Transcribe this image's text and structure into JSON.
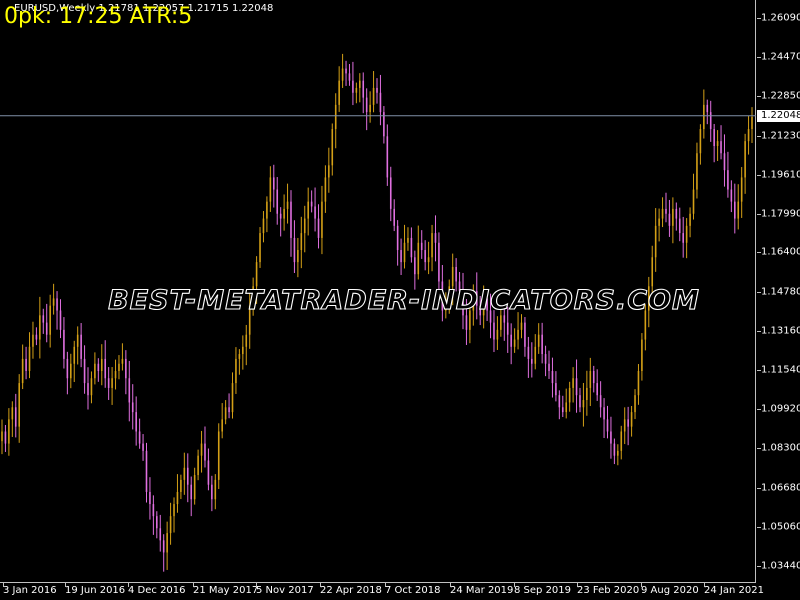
{
  "chart": {
    "symbol_title": "EURUSD,Weekly  1.21781 1.22057 1.21715 1.22048",
    "indicator_text": "0pk: 17:25 ATR:5",
    "watermark": "BEST-METATRADER-INDICATORS.COM",
    "current_price": "1.22048",
    "price_labels": [
      "1.26090",
      "1.24470",
      "1.22850",
      "1.21230",
      "1.19610",
      "1.17990",
      "1.16400",
      "1.14780",
      "1.13160",
      "1.11540",
      "1.09920",
      "1.08300",
      "1.06680",
      "1.05060",
      "1.03440"
    ],
    "time_labels": [
      "3 Jan 2016",
      "19 Jun 2016",
      "4 Dec 2016",
      "21 May 2017",
      "5 Nov 2017",
      "22 Apr 2018",
      "7 Oct 2018",
      "24 Mar 2019",
      "8 Sep 2019",
      "23 Feb 2020",
      "9 Aug 2020",
      "24 Jan 2021"
    ],
    "colors": {
      "background": "#000000",
      "bull": "#d4a017",
      "bear": "#e070e0",
      "axis_text": "#ffffff",
      "indicator": "#ffff00",
      "current_line": "#8090a8"
    }
  },
  "chart_data": {
    "type": "candlestick",
    "title": "EURUSD,Weekly",
    "ylim": [
      1.0344,
      1.2609
    ],
    "series": [
      {
        "name": "EURUSD",
        "values": [
          1.09,
          1.085,
          1.095,
          1.1,
          1.092,
          1.11,
          1.12,
          1.115,
          1.125,
          1.13,
          1.128,
          1.138,
          1.135,
          1.13,
          1.142,
          1.145,
          1.14,
          1.132,
          1.12,
          1.112,
          1.118,
          1.125,
          1.13,
          1.12,
          1.11,
          1.105,
          1.112,
          1.118,
          1.115,
          1.12,
          1.112,
          1.108,
          1.112,
          1.115,
          1.118,
          1.12,
          1.112,
          1.102,
          1.098,
          1.09,
          1.085,
          1.082,
          1.065,
          1.06,
          1.055,
          1.05,
          1.045,
          1.04,
          1.048,
          1.055,
          1.06,
          1.065,
          1.07,
          1.075,
          1.068,
          1.062,
          1.072,
          1.08,
          1.085,
          1.078,
          1.068,
          1.062,
          1.07,
          1.09,
          1.095,
          1.1,
          1.098,
          1.11,
          1.12,
          1.122,
          1.125,
          1.13,
          1.142,
          1.15,
          1.16,
          1.172,
          1.178,
          1.185,
          1.195,
          1.19,
          1.18,
          1.178,
          1.182,
          1.185,
          1.17,
          1.16,
          1.165,
          1.172,
          1.178,
          1.185,
          1.183,
          1.178,
          1.17,
          1.185,
          1.195,
          1.2,
          1.215,
          1.225,
          1.235,
          1.24,
          1.238,
          1.235,
          1.23,
          1.232,
          1.235,
          1.228,
          1.222,
          1.225,
          1.232,
          1.23,
          1.222,
          1.212,
          1.195,
          1.182,
          1.175,
          1.165,
          1.16,
          1.168,
          1.17,
          1.162,
          1.155,
          1.168,
          1.165,
          1.16,
          1.162,
          1.172,
          1.168,
          1.152,
          1.14,
          1.145,
          1.15,
          1.158,
          1.152,
          1.148,
          1.138,
          1.132,
          1.14,
          1.148,
          1.142,
          1.138,
          1.145,
          1.14,
          1.135,
          1.128,
          1.132,
          1.138,
          1.135,
          1.13,
          1.125,
          1.128,
          1.132,
          1.135,
          1.125,
          1.12,
          1.118,
          1.125,
          1.13,
          1.122,
          1.118,
          1.115,
          1.11,
          1.105,
          1.1,
          1.098,
          1.102,
          1.108,
          1.112,
          1.105,
          1.1,
          1.103,
          1.108,
          1.115,
          1.11,
          1.105,
          1.1,
          1.095,
          1.09,
          1.085,
          1.08,
          1.082,
          1.09,
          1.095,
          1.092,
          1.098,
          1.105,
          1.115,
          1.128,
          1.14,
          1.15,
          1.162,
          1.175,
          1.178,
          1.182,
          1.18,
          1.175,
          1.182,
          1.178,
          1.172,
          1.168,
          1.175,
          1.18,
          1.19,
          1.205,
          1.215,
          1.225,
          1.222,
          1.215,
          1.208,
          1.21,
          1.205,
          1.198,
          1.19,
          1.185,
          1.178,
          1.185,
          1.195,
          1.21,
          1.215,
          1.22
        ]
      }
    ],
    "x": [
      "3 Jan 2016",
      "19 Jun 2016",
      "4 Dec 2016",
      "21 May 2017",
      "5 Nov 2017",
      "22 Apr 2018",
      "7 Oct 2018",
      "24 Mar 2019",
      "8 Sep 2019",
      "23 Feb 2020",
      "9 Aug 2020",
      "24 Jan 2021"
    ],
    "current": 1.22048
  }
}
